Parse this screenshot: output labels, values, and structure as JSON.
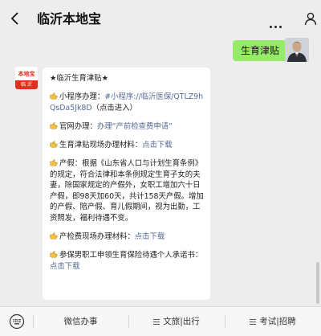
{
  "header": {
    "title": "临沂本地宝"
  },
  "outgoing": {
    "text": "生育津贴"
  },
  "account": {
    "logo_top": "本地宝",
    "logo_bottom": "临 沂"
  },
  "message": {
    "heading": "★临沂生育津贴★",
    "mini_program_label": "小程序办理：",
    "mini_program_link": "#小程序://临沂医保/QTLZ9hQsDa5Jk8D",
    "mini_program_note": "（点击进入）",
    "website_label": "官网办理：",
    "website_link": "办理“产前检查费申请”",
    "materials_label": "生育津贴现场办理材料：",
    "materials_link": "点击下载",
    "leave_text": "产假：根据《山东省人口与计划生育条例》的规定，符合法律和本条例规定生育子女的夫妻，除国家规定的产假外，女职工增加六十日产假，即98天加60天，共计158天产假。增加的产假、陪产假、育儿假期间，视为出勤，工资照发，福利待遇不变。",
    "checkup_label": "产检费现场办理材料：",
    "checkup_link": "点击下载",
    "male_label": "参保男职工申领生育保险待遇个人承诺书：",
    "male_link": "点击下载"
  },
  "menu": {
    "items": [
      "微信办事",
      "文旅|出行",
      "考试|招聘"
    ]
  },
  "colors": {
    "bubble_out": "#95ec69",
    "link": "#576b95",
    "brand": "#e0301e"
  }
}
